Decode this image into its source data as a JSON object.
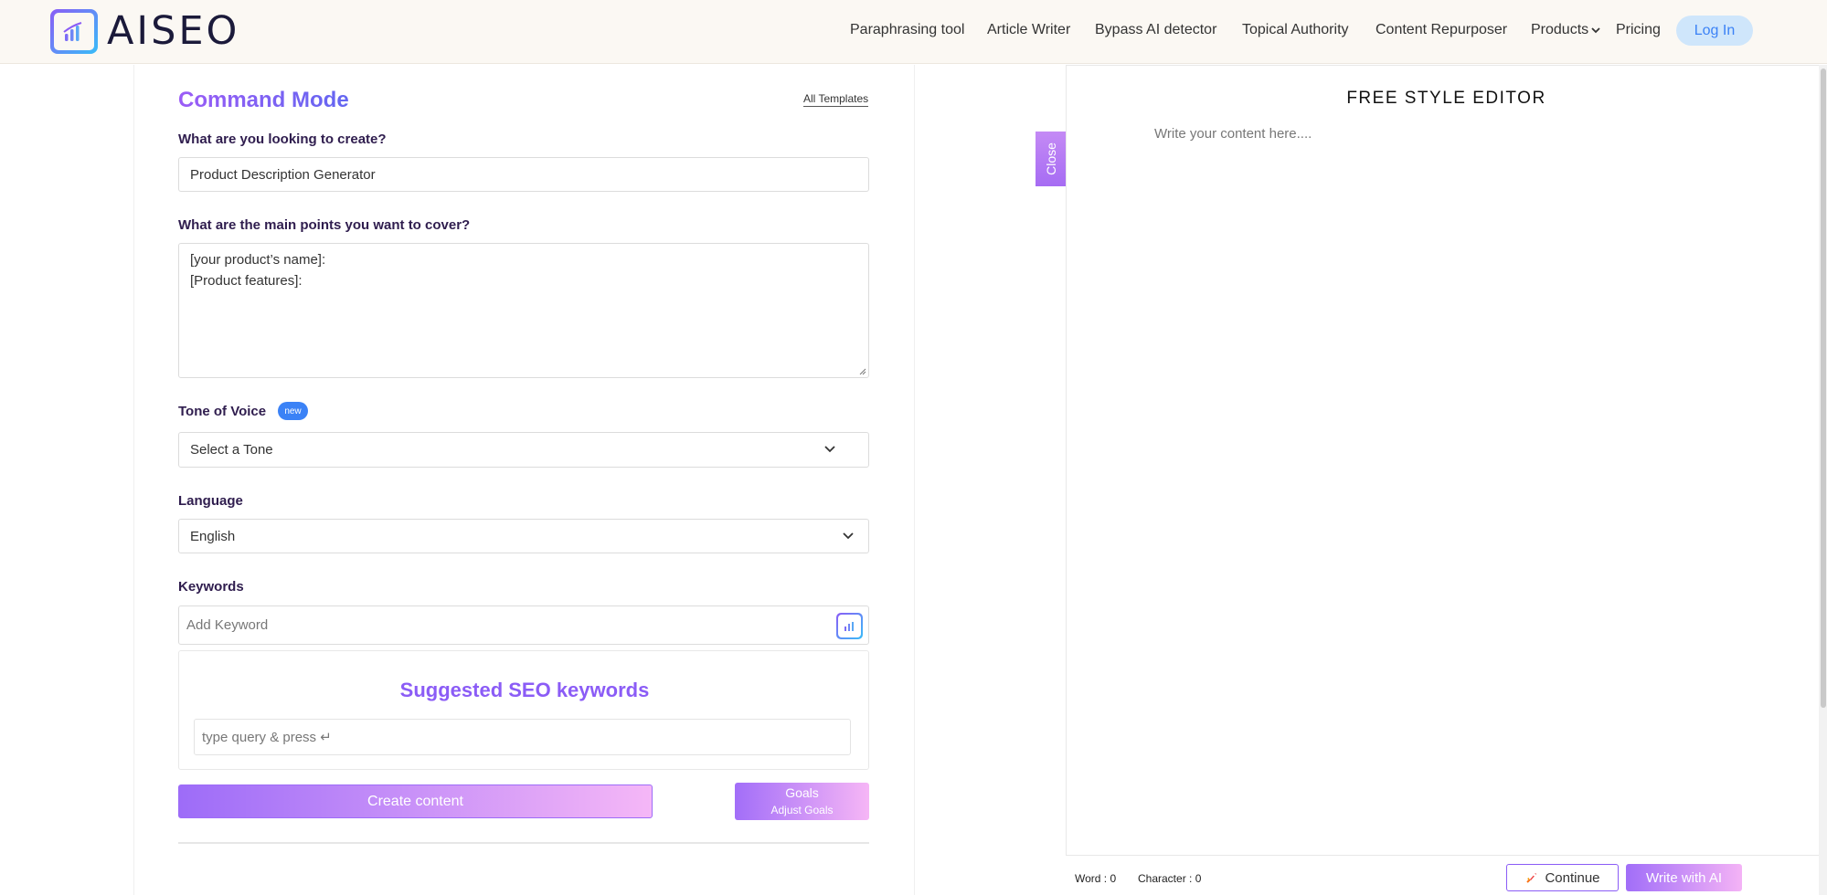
{
  "header": {
    "logo_text": "AISEO",
    "nav": [
      {
        "label": "Paraphrasing tool"
      },
      {
        "label": "Article Writer"
      },
      {
        "label": "Bypass AI detector"
      },
      {
        "label": "Topical Authority"
      },
      {
        "label": "Content Repurposer"
      },
      {
        "label": "Products"
      },
      {
        "label": "Pricing"
      }
    ],
    "login_label": "Log In"
  },
  "command": {
    "title": "Command Mode",
    "all_templates": "All Templates",
    "create_label": "What are you looking to create?",
    "create_value": "Product Description Generator",
    "points_label": "What are the main points you want to cover?",
    "points_lines": [
      "[your product’s name]:",
      "[Product features]:"
    ],
    "tone_label": "Tone of Voice",
    "tone_badge": "new",
    "tone_value": "Select a Tone",
    "language_label": "Language",
    "language_value": "English",
    "keywords_label": "Keywords",
    "keywords_placeholder": "Add Keyword",
    "seo_title": "Suggested SEO keywords",
    "seo_placeholder": "type query & press ↵",
    "create_button": "Create content",
    "goals_title": "Goals",
    "goals_sub": "Adjust Goals"
  },
  "close_label": "Close",
  "editor": {
    "title": "FREE STYLE EDITOR",
    "placeholder": "Write your content here....",
    "word_count": "Word : 0",
    "char_count": "Character : 0",
    "continue_label": "Continue",
    "write_ai_label": "Write with AI"
  },
  "colors": {
    "accent": "#8b5cf6",
    "login_bg": "#cfe6fb",
    "badge": "#3b82f6"
  }
}
